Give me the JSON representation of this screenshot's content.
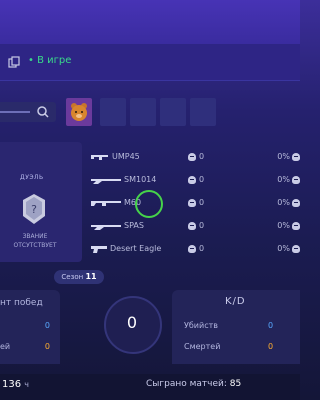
{
  "header": {
    "status_text": "• В игре"
  },
  "left_panel": {
    "mode_label": "ДУЭЛЬ",
    "rank_text": "ЗВАНИЕ ОТСУТСТВУЕТ"
  },
  "weapons": [
    {
      "name": "UMP45",
      "kills": "0",
      "percent": "0%"
    },
    {
      "name": "SM1014",
      "kills": "0",
      "percent": "0%"
    },
    {
      "name": "M60",
      "kills": "0",
      "percent": "0%"
    },
    {
      "name": "SPAS",
      "kills": "0",
      "percent": "0%"
    },
    {
      "name": "Desert Eagle",
      "kills": "0",
      "percent": "0%"
    }
  ],
  "season": {
    "label": "Сезон",
    "number": "11"
  },
  "wins": {
    "label": "нт побед",
    "row1_label": "",
    "row1_value": "0",
    "row2_label": "ей",
    "row2_value": "0"
  },
  "center": {
    "value": "0"
  },
  "kd": {
    "label": "K/D",
    "kills_label": "Убийств",
    "kills_value": "0",
    "deaths_label": "Смертей",
    "deaths_value": "0"
  },
  "footer": {
    "hours_value": "136",
    "hours_unit": "ч",
    "matches_label": "Сыграно матчей:",
    "matches_value": "85"
  },
  "colors": {
    "accent": "#3c2e9a",
    "online": "#39d98a",
    "highlight": "#46d34a",
    "orange": "#ffae2e",
    "blue": "#58a8ff"
  },
  "icons": {
    "copy": "copy-icon",
    "search": "search-icon",
    "skull": "skull-icon"
  }
}
